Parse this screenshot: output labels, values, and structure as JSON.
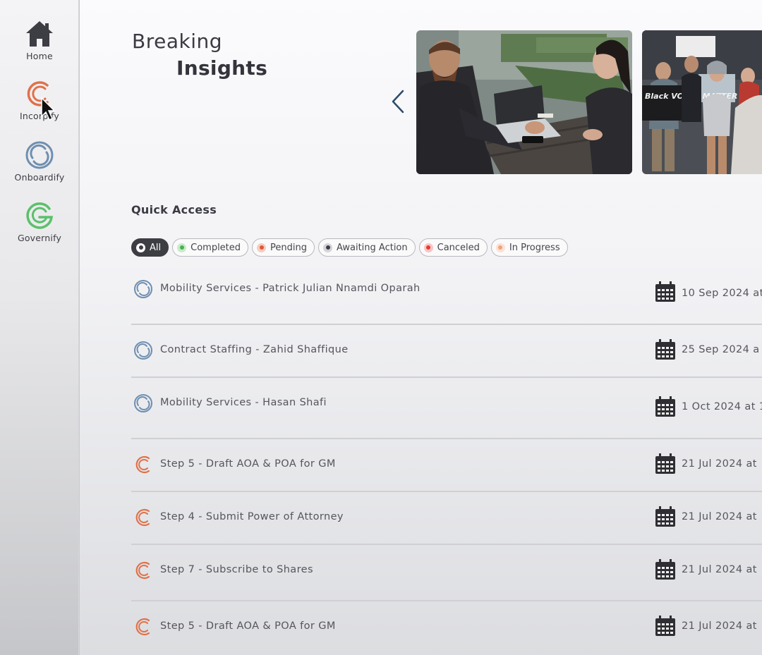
{
  "sidebar": {
    "items": [
      {
        "label": "Home",
        "icon": "home-icon"
      },
      {
        "label": "Incorpify",
        "icon": "incorpify-icon"
      },
      {
        "label": "Onboardify",
        "icon": "onboardify-icon"
      },
      {
        "label": "Governify",
        "icon": "governify-icon"
      }
    ]
  },
  "header": {
    "title_line1": "Breaking",
    "title_line2": "Insights"
  },
  "carousel": {
    "images": [
      "business-meeting-photo",
      "protest-photo"
    ],
    "protest_sign_text": "Black VOTES MATTER"
  },
  "quick_access": {
    "title": "Quick Access",
    "filters": [
      {
        "label": "All",
        "color": "#3d3d44",
        "active": true
      },
      {
        "label": "Completed",
        "color": "#4caf50",
        "active": false
      },
      {
        "label": "Pending",
        "color": "#e0573a",
        "active": false
      },
      {
        "label": "Awaiting Action",
        "color": "#3d3d44",
        "active": false
      },
      {
        "label": "Canceled",
        "color": "#e53935",
        "active": false
      },
      {
        "label": "In Progress",
        "color": "#f0a27c",
        "active": false
      }
    ],
    "rows": [
      {
        "title": "Mobility Services - Patrick Julian Nnamdi Oparah",
        "date": "10 Sep 2024 at",
        "app": "onboardify"
      },
      {
        "title": "Contract Staffing - Zahid Shaffique",
        "date": "25 Sep 2024 a",
        "app": "onboardify"
      },
      {
        "title": "Mobility Services - Hasan Shafi",
        "date": "1 Oct 2024 at 1",
        "app": "onboardify"
      },
      {
        "title": "Step 5 - Draft AOA & POA for GM",
        "date": "21 Jul 2024 at",
        "app": "incorpify"
      },
      {
        "title": "Step 4 - Submit Power of Attorney",
        "date": "21 Jul 2024 at",
        "app": "incorpify"
      },
      {
        "title": "Step 7 - Subscribe to Shares",
        "date": "21 Jul 2024 at",
        "app": "incorpify"
      },
      {
        "title": "Step 5 - Draft AOA & POA for GM",
        "date": "21 Jul 2024 at",
        "app": "incorpify"
      }
    ]
  },
  "colors": {
    "incorpify": "#e0714a",
    "onboardify": "#6f8fb0",
    "governify": "#5cc06b",
    "text_dark": "#3a3a42"
  }
}
